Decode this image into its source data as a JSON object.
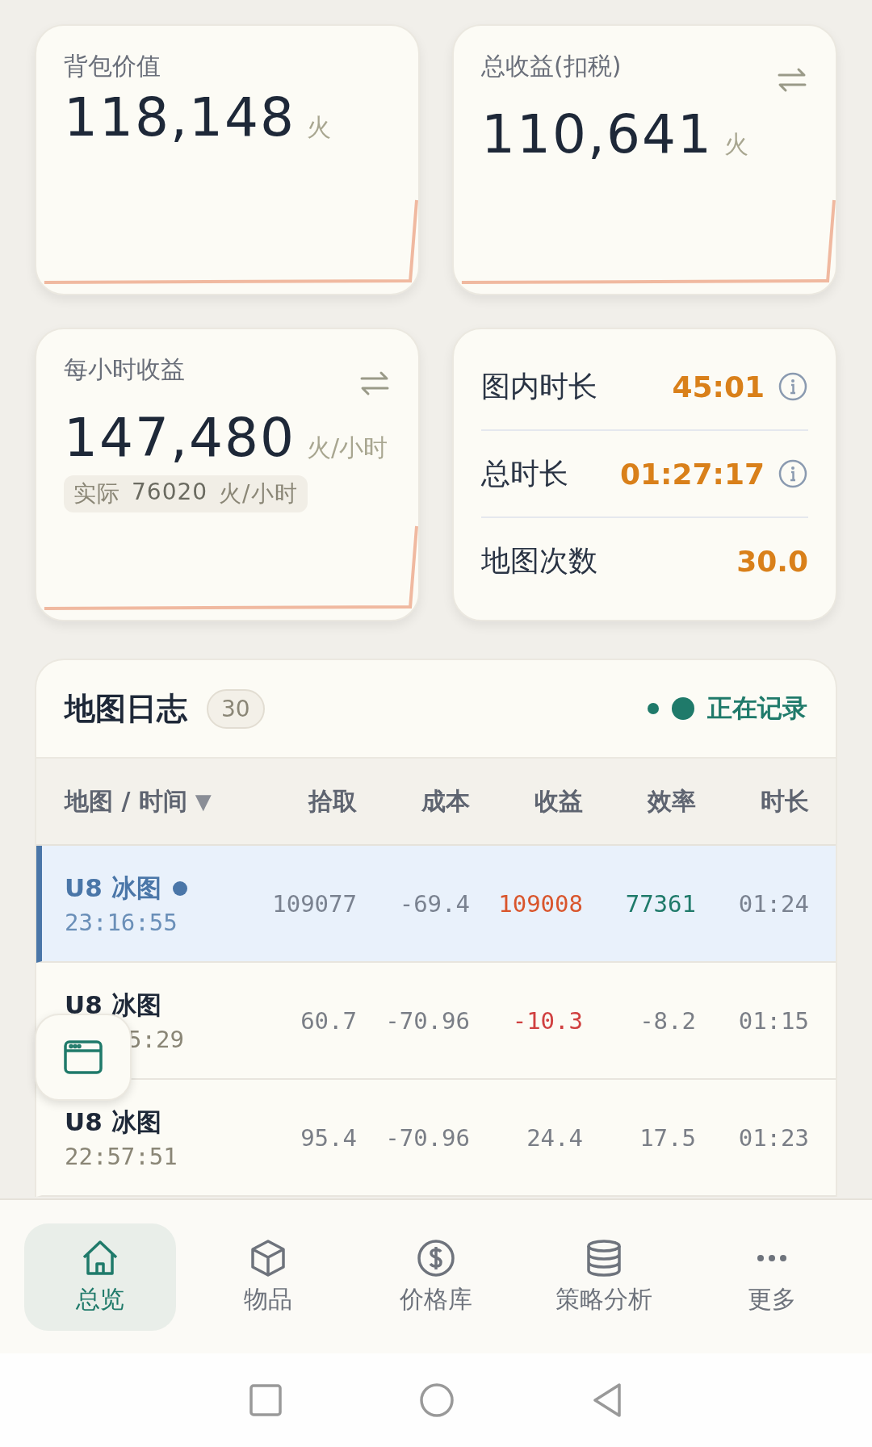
{
  "stat_cards": [
    {
      "title": "背包价值",
      "value": "118,148",
      "unit": "火",
      "swap": false
    },
    {
      "title": "总收益(扣税)",
      "value": "110,641",
      "unit": "火",
      "swap": true
    },
    {
      "title": "每小时收益",
      "value": "147,480",
      "unit": "火/小时",
      "swap": true,
      "note": {
        "label": "实际",
        "value": "76020",
        "unit": "火/小时"
      }
    }
  ],
  "time_card": {
    "rows": [
      {
        "label": "图内时长",
        "value": "45:01",
        "info": true
      },
      {
        "label": "总时长",
        "value": "01:27:17",
        "info": true
      },
      {
        "label": "地图次数",
        "value": "30.0",
        "info": false
      }
    ]
  },
  "map_log": {
    "title": "地图日志",
    "count": "30",
    "recording": {
      "on": true,
      "label": "正在记录"
    },
    "columns": [
      {
        "label": "地图 / 时间",
        "sort": "▼"
      },
      {
        "label": "拾取"
      },
      {
        "label": "成本"
      },
      {
        "label": "收益"
      },
      {
        "label": "效率"
      },
      {
        "label": "时长"
      }
    ],
    "rows": [
      {
        "selected": true,
        "cells": [
          {
            "map": "U8 冰图",
            "time": "23:16:55",
            "live": true,
            "covered": false
          },
          {
            "text": "109077"
          },
          {
            "text": "-69.4"
          },
          {
            "text": "109008",
            "color": "#d9552c"
          },
          {
            "text": "77361",
            "color": "#1f7a6a"
          },
          {
            "text": "01:24"
          }
        ]
      },
      {
        "selected": false,
        "cells": [
          {
            "map": "U8 冰图",
            "time": "5:29",
            "live": false,
            "covered": true
          },
          {
            "text": "60.7"
          },
          {
            "text": "-70.96"
          },
          {
            "text": "-10.3",
            "color": "#d04040"
          },
          {
            "text": "-8.2"
          },
          {
            "text": "01:15"
          }
        ]
      },
      {
        "selected": false,
        "cells": [
          {
            "map": "U8 冰图",
            "time": "22:57:51",
            "live": false,
            "covered": false
          },
          {
            "text": "95.4"
          },
          {
            "text": "-70.96"
          },
          {
            "text": "24.4"
          },
          {
            "text": "17.5"
          },
          {
            "text": "01:23"
          }
        ]
      }
    ]
  },
  "bottom_nav": [
    {
      "kind": "home",
      "label": "总览",
      "selected": true
    },
    {
      "kind": "box",
      "label": "物品",
      "selected": false
    },
    {
      "kind": "dollar",
      "label": "价格库",
      "selected": false
    },
    {
      "kind": "database",
      "label": "策略分析",
      "selected": false
    },
    {
      "kind": "more",
      "label": "更多",
      "selected": false
    }
  ]
}
